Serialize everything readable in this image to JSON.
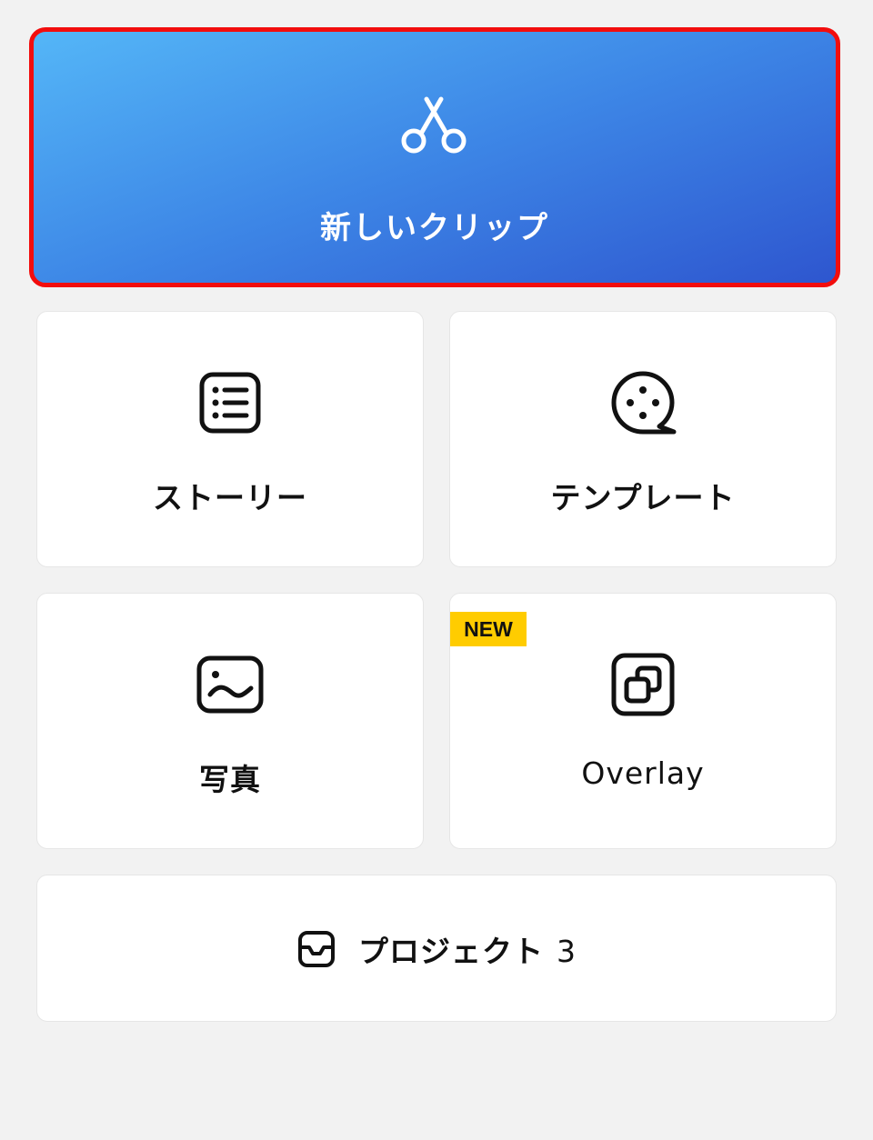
{
  "new_clip": {
    "label": "新しいクリップ",
    "icon": "scissors-icon"
  },
  "tiles": [
    {
      "label": "ストーリー",
      "icon": "list-icon"
    },
    {
      "label": "テンプレート",
      "icon": "film-reel-icon"
    },
    {
      "label": "写真",
      "icon": "photo-icon"
    },
    {
      "label": "Overlay",
      "icon": "overlay-icon",
      "badge": "NEW"
    }
  ],
  "projects": {
    "label": "プロジェクト",
    "count": "3",
    "icon": "inbox-icon"
  },
  "colors": {
    "gradient_start": "#54b6f7",
    "gradient_end": "#2e56cf",
    "highlight_border": "#f20d0d",
    "badge": "#ffcc00",
    "background": "#f2f2f2"
  }
}
